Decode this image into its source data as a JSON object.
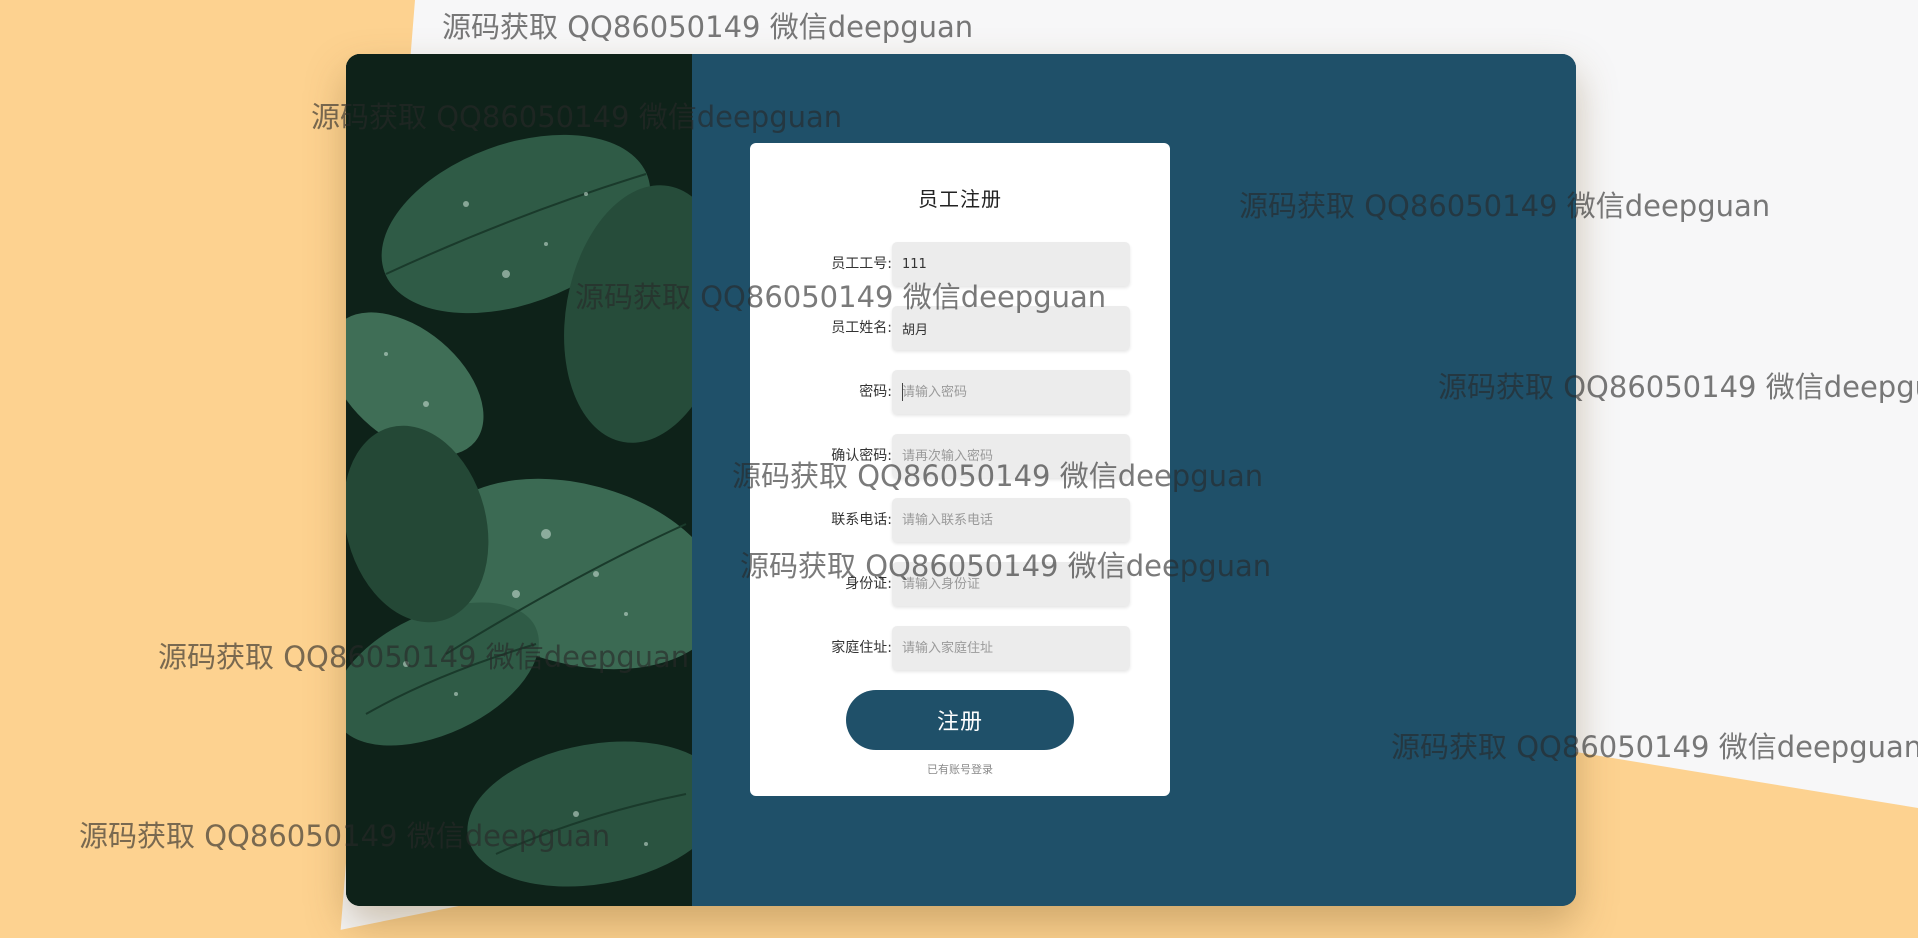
{
  "form": {
    "title": "员工注册",
    "fields": [
      {
        "label": "员工工号:",
        "value": "111",
        "placeholder": ""
      },
      {
        "label": "员工姓名:",
        "value": "胡月",
        "placeholder": ""
      },
      {
        "label": "密码:",
        "value": "",
        "placeholder": "请输入密码"
      },
      {
        "label": "确认密码:",
        "value": "",
        "placeholder": "请再次输入密码"
      },
      {
        "label": "联系电话:",
        "value": "",
        "placeholder": "请输入联系电话"
      },
      {
        "label": "身份证:",
        "value": "",
        "placeholder": "请输入身份证"
      },
      {
        "label": "家庭住址:",
        "value": "",
        "placeholder": "请输入家庭住址"
      }
    ],
    "submit_label": "注册",
    "login_link": "已有账号登录"
  },
  "watermark": {
    "text": "源码获取 QQ86050149 微信deepguan"
  },
  "colors": {
    "panel": "#1f5069",
    "button": "#1f5069",
    "background_accent": "#fdd290",
    "input_bg": "#ececec"
  }
}
